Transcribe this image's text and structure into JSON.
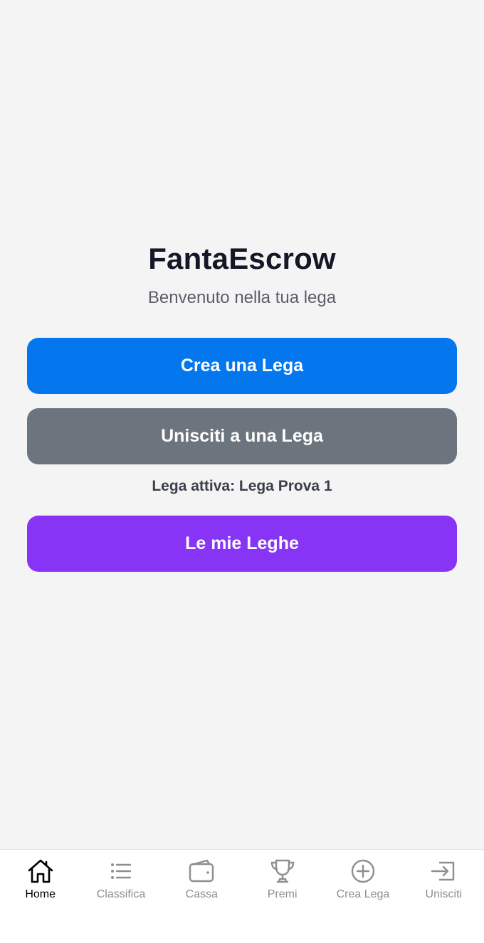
{
  "app": {
    "title": "FantaEscrow",
    "subtitle": "Benvenuto nella tua lega"
  },
  "actions": {
    "create_label": "Crea una Lega",
    "join_label": "Unisciti a una Lega",
    "active_league_text": "Lega attiva: Lega Prova 1",
    "my_leagues_label": "Le mie Leghe"
  },
  "colors": {
    "background": "#f4f4f5",
    "create_button": "#0476ee",
    "join_button": "#6c757d",
    "my_leagues_button": "#8734f6",
    "tab_active": "#000000",
    "tab_inactive": "#8e8e93"
  },
  "tabbar": {
    "active_tab": "Home",
    "items": [
      {
        "label": "Home",
        "icon": "home-icon"
      },
      {
        "label": "Classifica",
        "icon": "list-icon"
      },
      {
        "label": "Cassa",
        "icon": "wallet-icon"
      },
      {
        "label": "Premi",
        "icon": "trophy-icon"
      },
      {
        "label": "Crea Lega",
        "icon": "plus-circle-icon"
      },
      {
        "label": "Unisciti",
        "icon": "sign-in-icon"
      }
    ]
  }
}
